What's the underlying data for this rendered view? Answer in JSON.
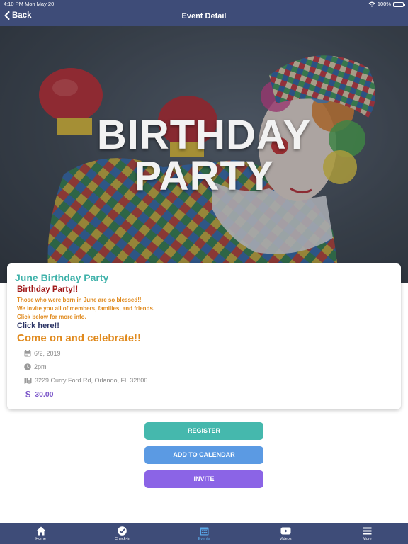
{
  "status_bar": {
    "time": "4:10 PM",
    "date": "Mon May 20",
    "battery": "100%"
  },
  "nav": {
    "back_label": "Back",
    "title": "Event Detail"
  },
  "hero": {
    "title_line1": "BIRTHDAY",
    "title_line2": "PARTY"
  },
  "event": {
    "name": "June Birthday Party",
    "headline": "Birthday Party!!",
    "description": [
      "Those who were born in June are so blessed!!",
      "We invite you all of members, families, and friends.",
      "Click below for more info."
    ],
    "link_text": "Click here!!",
    "tagline": "Come on and celebrate!!",
    "date": "6/2, 2019",
    "time": "2pm",
    "address": "3229 Curry Ford Rd, Orlando, FL 32806",
    "price_symbol": "$",
    "price": "30.00"
  },
  "actions": {
    "register": "REGISTER",
    "add_to_calendar": "ADD TO CALENDAR",
    "invite": "INVITE"
  },
  "tabs": [
    {
      "label": "Home",
      "icon": "home-icon"
    },
    {
      "label": "Check-in",
      "icon": "checkmark-circle-icon"
    },
    {
      "label": "Events",
      "icon": "calendar-icon",
      "active": true
    },
    {
      "label": "Videos",
      "icon": "video-play-icon"
    },
    {
      "label": "More",
      "icon": "menu-icon"
    }
  ],
  "colors": {
    "nav_bar": "#3e4c78",
    "teal": "#45b8ad",
    "blue": "#5b9ae3",
    "purple": "#8b64e6",
    "headline_red": "#a01818",
    "orange": "#e08a1e",
    "active_tab": "#5aa9ea"
  }
}
